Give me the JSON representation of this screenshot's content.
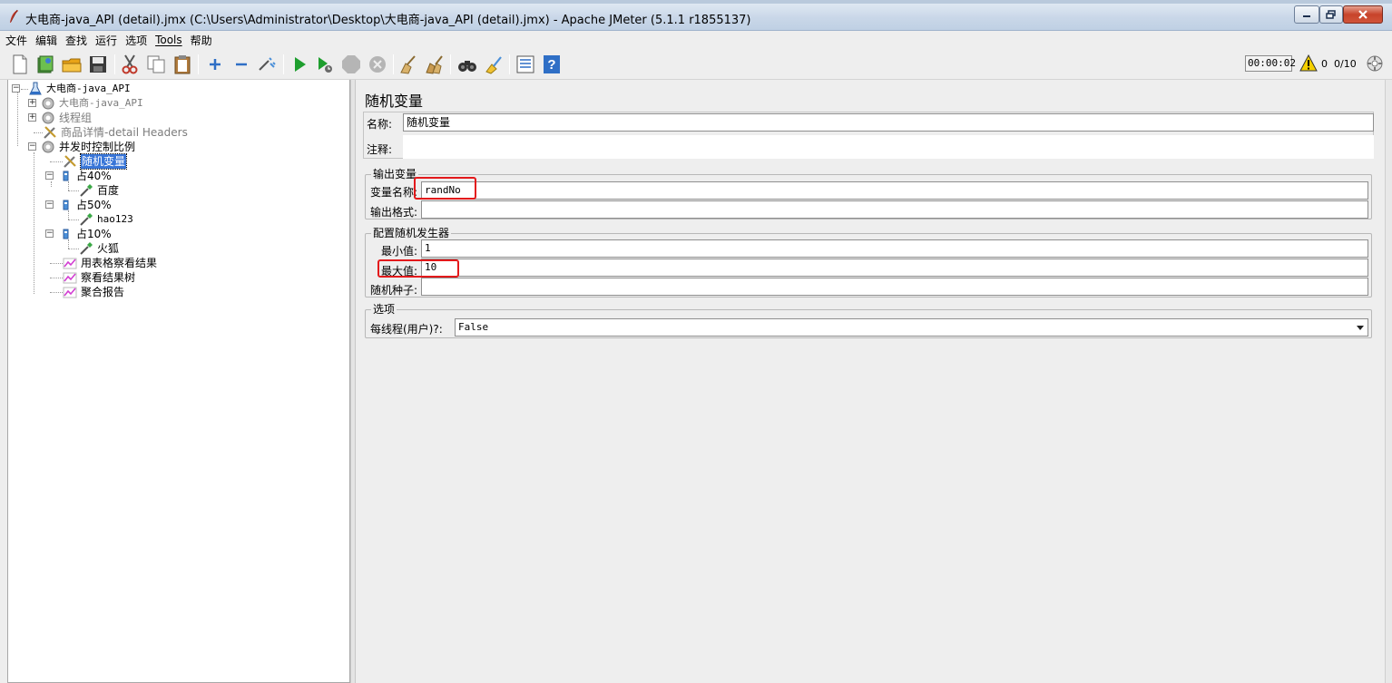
{
  "window": {
    "title": "大电商-java_API (detail).jmx (C:\\Users\\Administrator\\Desktop\\大电商-java_API (detail).jmx) - Apache JMeter (5.1.1 r1855137)"
  },
  "menu": [
    "文件",
    "编辑",
    "查找",
    "运行",
    "选项",
    "Tools",
    "帮助"
  ],
  "status": {
    "timer": "00:00:02",
    "errors": "0",
    "threads": "0/10"
  },
  "tree": {
    "root": "大电商-java_API",
    "items": [
      "大电商-java_API",
      "线程组",
      "商品详情-detail Headers",
      "并发时控制比例",
      "随机变量",
      "占40%",
      "百度",
      "占50%",
      "hao123",
      "占10%",
      "火狐",
      "用表格察看结果",
      "察看结果树",
      "聚合报告"
    ]
  },
  "panel": {
    "title": "随机变量",
    "name_label": "名称:",
    "name_value": "随机变量",
    "comment_label": "注释:",
    "output_group": "输出变量",
    "var_name_label": "变量名称:",
    "var_name_value": "randNo",
    "output_format_label": "输出格式:",
    "output_format_value": "",
    "generator_group": "配置随机发生器",
    "min_label": "最小值:",
    "min_value": "1",
    "max_label": "最大值:",
    "max_value": "10",
    "seed_label": "随机种子:",
    "seed_value": "",
    "options_group": "选项",
    "per_thread_label": "每线程(用户)?:",
    "per_thread_value": "False"
  },
  "colors": {
    "selection": "#3875d7",
    "highlight_box": "#e3191b"
  }
}
